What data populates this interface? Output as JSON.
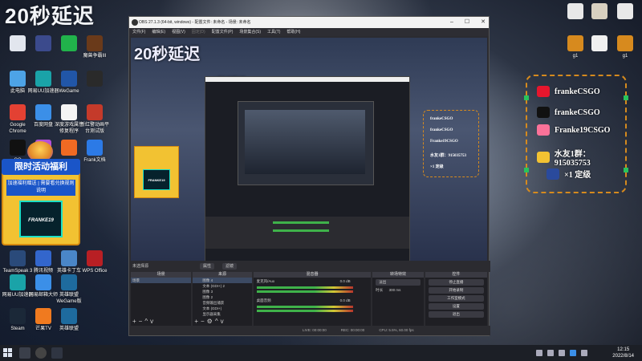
{
  "desktop": {
    "overlay_title": "20秒延迟",
    "left_icons": [
      {
        "label": "",
        "color": "#e2e6ee"
      },
      {
        "label": "",
        "color": "#3b4a8c"
      },
      {
        "label": "",
        "color": "#21b34b"
      },
      {
        "label": "魔兽争霸III",
        "color": "#6a3a1a"
      },
      {
        "label": "此电脑",
        "color": "#4da3e6"
      },
      {
        "label": "网易UU加速器",
        "color": "#1aa3a8"
      },
      {
        "label": "WeGame",
        "color": "#2156a8"
      },
      {
        "label": "",
        "color": "#2a2a2a"
      },
      {
        "label": "Google Chrome",
        "color": "#e34133"
      },
      {
        "label": "百度网盘",
        "color": "#3b8fe8"
      },
      {
        "label": "深度游戏属性修复程序",
        "color": "#f4f4f4"
      },
      {
        "label": "新红警动画平台测试版",
        "color": "#c43a2a"
      },
      {
        "label": "QQ",
        "color": "#111111"
      },
      {
        "label": "",
        "color": "#b34fd8"
      },
      {
        "label": "",
        "color": "#f06a23"
      },
      {
        "label": "Frank文档",
        "color": "#2c7ae6"
      },
      {
        "label": "TeamSpeak 3",
        "color": "#2a4a7a"
      },
      {
        "label": "腾讯视频",
        "color": "#3366cc"
      },
      {
        "label": "英雄卡丁车",
        "color": "#4a86c8"
      },
      {
        "label": "网易UU加速器",
        "color": "#1aa3a8"
      },
      {
        "label": "网易邮箱大师",
        "color": "#3b8fe8"
      },
      {
        "label": "英雄联盟WeGame版",
        "color": "#1e6b9e"
      },
      {
        "label": "Steam",
        "color": "#1b2838"
      },
      {
        "label": "芒果TV",
        "color": "#f07a1f"
      },
      {
        "label": "英雄联盟",
        "color": "#1e6b9e"
      },
      {
        "label": "WPS Office",
        "color": "#b81f24"
      }
    ],
    "right_icons": [
      {
        "label": "",
        "color": "#e8e8e8"
      },
      {
        "label": "",
        "color": "#d8d0c0"
      },
      {
        "label": "",
        "color": "#e8e8e8"
      },
      {
        "label": "g1",
        "color": "#d78a1e"
      },
      {
        "label": "",
        "color": "#f0f0f0"
      },
      {
        "label": "g1",
        "color": "#d78a1e"
      }
    ]
  },
  "promo": {
    "top_text": "限时活动福利",
    "line2": "加速福利赠送 | 需要看兑换规则说明",
    "card_text": "FRANKE19"
  },
  "social": {
    "items": [
      {
        "icon": "weibo-icon",
        "text": "frankeCSGO",
        "color": "#e6162d"
      },
      {
        "icon": "tiktok-icon",
        "text": "frankeCSGO",
        "color": "#111111"
      },
      {
        "icon": "bilibili-icon",
        "text": "Franke19CSGO",
        "color": "#fb7299"
      },
      {
        "icon": "qq-group-icon",
        "text": "水友1群：915035753",
        "color": "#f2c232"
      },
      {
        "icon": "rocket-icon",
        "text": "×1 定级",
        "color": "#2a4a9c"
      }
    ]
  },
  "obs": {
    "title": "OBS 27.1.3 (64-bit, windows) - 配置文件: 未命名 - 场景: 未命名",
    "menu": [
      "文件(F)",
      "编辑(E)",
      "视图(V)",
      "固定(D)",
      "配置文件(P)",
      "场景集合(S)",
      "工具(T)",
      "帮助(H)"
    ],
    "scene_label": "未选择源",
    "scene_buttons": [
      "属性",
      "滤镜"
    ],
    "docks": {
      "scenes": {
        "title": "场景",
        "items": [
          "场景"
        ]
      },
      "sources": {
        "title": "来源",
        "items": [
          "图像 4",
          "文本 (GDI+) 2",
          "图像 3",
          "图像 2",
          "音频输出捕获",
          "文本 (GDI+)",
          "显示器采集"
        ]
      },
      "mixer": {
        "title": "混音器",
        "tracks": [
          {
            "name": "麦克风/Aux",
            "db": "0.0 dB"
          },
          {
            "name": "桌面音频",
            "db": "0.0 dB"
          }
        ]
      },
      "transitions": {
        "title": "转场特效",
        "type": "淡出",
        "duration_label": "时长",
        "duration": "300 ms"
      },
      "controls": {
        "title": "控件",
        "buttons": [
          "停止直播",
          "开始录制",
          "工作室模式",
          "设置",
          "退出"
        ]
      }
    },
    "status": [
      "LIVE: 00:00:00",
      "REC: 00:00:00",
      "CPU: 5.5%, 60.00 fps"
    ]
  },
  "taskbar": {
    "time": "12:15",
    "date": "2022/8/14"
  }
}
